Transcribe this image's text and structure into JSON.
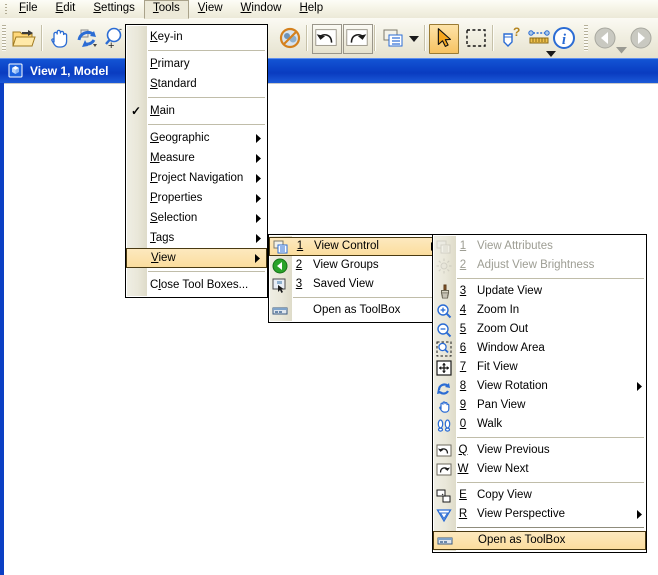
{
  "window": {
    "view_title": "View 1, Model",
    "view_title_icon": "view-cube-icon"
  },
  "menubar": {
    "items": [
      {
        "label": "File",
        "accel": "F",
        "open": false,
        "name": "menu-file"
      },
      {
        "label": "Edit",
        "accel": "E",
        "open": false,
        "name": "menu-edit"
      },
      {
        "label": "Settings",
        "accel": "S",
        "open": false,
        "name": "menu-settings"
      },
      {
        "label": "Tools",
        "accel": "T",
        "open": true,
        "name": "menu-tools"
      },
      {
        "label": "View",
        "accel": "V",
        "open": false,
        "name": "menu-view"
      },
      {
        "label": "Window",
        "accel": "W",
        "open": false,
        "name": "menu-window"
      },
      {
        "label": "Help",
        "accel": "H",
        "open": false,
        "name": "menu-help"
      }
    ]
  },
  "toolbar": {
    "buttons": [
      {
        "name": "open-folder-icon",
        "selected": false
      },
      {
        "name": "pan-hand-icon",
        "selected": false
      },
      {
        "name": "rotate-view-icon",
        "selected": false
      },
      {
        "name": "zoom-in-icon",
        "selected": false
      },
      {
        "name": "toolbox-icon",
        "selected": false
      },
      {
        "name": "no-entry-icon",
        "selected": false
      },
      {
        "name": "undo-icon",
        "selected": false
      },
      {
        "name": "redo-icon",
        "selected": false
      },
      {
        "name": "view-groups-icon",
        "selected": false
      },
      {
        "name": "select-arrow-icon",
        "selected": true
      },
      {
        "name": "fence-select-icon",
        "selected": false
      },
      {
        "name": "element-info-icon",
        "selected": false
      },
      {
        "name": "measure-distance-icon",
        "selected": false
      },
      {
        "name": "info-icon",
        "selected": false
      },
      {
        "name": "back-arrow-icon",
        "selected": false
      },
      {
        "name": "forward-arrow-icon",
        "selected": false
      }
    ]
  },
  "tools_menu": {
    "items": [
      {
        "type": "item",
        "label": "Key-in",
        "accel": "K",
        "checked": false,
        "submenu": false,
        "disabled": false,
        "highlighted": false,
        "name": "tools-key-in"
      },
      {
        "type": "sep"
      },
      {
        "type": "item",
        "label": "Primary",
        "accel": "P",
        "checked": false,
        "submenu": false,
        "disabled": false,
        "highlighted": false,
        "name": "tools-primary"
      },
      {
        "type": "item",
        "label": "Standard",
        "accel": "S",
        "checked": false,
        "submenu": false,
        "disabled": false,
        "highlighted": false,
        "name": "tools-standard"
      },
      {
        "type": "sep"
      },
      {
        "type": "item",
        "label": "Main",
        "accel": "M",
        "checked": true,
        "submenu": false,
        "disabled": false,
        "highlighted": false,
        "name": "tools-main"
      },
      {
        "type": "sep"
      },
      {
        "type": "item",
        "label": "Geographic",
        "accel": "G",
        "checked": false,
        "submenu": true,
        "disabled": false,
        "highlighted": false,
        "name": "tools-geographic"
      },
      {
        "type": "item",
        "label": "Measure",
        "accel": "M",
        "checked": false,
        "submenu": true,
        "disabled": false,
        "highlighted": false,
        "name": "tools-measure"
      },
      {
        "type": "item",
        "label": "Project Navigation",
        "accel": "P",
        "checked": false,
        "submenu": true,
        "disabled": false,
        "highlighted": false,
        "name": "tools-project-navigation"
      },
      {
        "type": "item",
        "label": "Properties",
        "accel": "P",
        "checked": false,
        "submenu": true,
        "disabled": false,
        "highlighted": false,
        "name": "tools-properties"
      },
      {
        "type": "item",
        "label": "Selection",
        "accel": "S",
        "checked": false,
        "submenu": true,
        "disabled": false,
        "highlighted": false,
        "name": "tools-selection"
      },
      {
        "type": "item",
        "label": "Tags",
        "accel": "T",
        "checked": false,
        "submenu": true,
        "disabled": false,
        "highlighted": false,
        "name": "tools-tags"
      },
      {
        "type": "item",
        "label": "View",
        "accel": "V",
        "checked": false,
        "submenu": true,
        "disabled": false,
        "highlighted": true,
        "name": "tools-view"
      },
      {
        "type": "sep"
      },
      {
        "type": "item",
        "label": "Close Tool Boxes...",
        "accel": "l",
        "checked": false,
        "submenu": false,
        "disabled": false,
        "highlighted": false,
        "name": "tools-close-tool-boxes"
      }
    ]
  },
  "view_submenu": {
    "items": [
      {
        "type": "item",
        "num": "1",
        "label": "View Control",
        "submenu": true,
        "highlighted": true,
        "icon": "view-control-icon",
        "name": "view-control"
      },
      {
        "type": "item",
        "num": "2",
        "label": "View Groups",
        "submenu": true,
        "highlighted": false,
        "icon": "view-groups-green-icon",
        "name": "view-groups"
      },
      {
        "type": "item",
        "num": "3",
        "label": "Saved View",
        "submenu": true,
        "highlighted": false,
        "icon": "saved-view-icon",
        "name": "saved-view"
      },
      {
        "type": "sep"
      },
      {
        "type": "item",
        "num": "",
        "label": "Open as ToolBox",
        "submenu": false,
        "highlighted": false,
        "icon": "toolbox-bar-icon",
        "name": "view-open-as-toolbox"
      }
    ]
  },
  "view_control_submenu": {
    "items": [
      {
        "type": "item",
        "num": "1",
        "label": "View Attributes",
        "disabled": true,
        "submenu": false,
        "highlighted": false,
        "icon": "view-attributes-icon",
        "name": "vc-view-attributes"
      },
      {
        "type": "item",
        "num": "2",
        "label": "Adjust View Brightness",
        "disabled": true,
        "submenu": false,
        "highlighted": false,
        "icon": "brightness-icon",
        "name": "vc-adjust-view-brightness"
      },
      {
        "type": "sep"
      },
      {
        "type": "item",
        "num": "3",
        "label": "Update View",
        "disabled": false,
        "submenu": false,
        "highlighted": false,
        "icon": "update-view-brush-icon",
        "name": "vc-update-view"
      },
      {
        "type": "item",
        "num": "4",
        "label": "Zoom In",
        "disabled": false,
        "submenu": false,
        "highlighted": false,
        "icon": "zoom-in-icon",
        "name": "vc-zoom-in"
      },
      {
        "type": "item",
        "num": "5",
        "label": "Zoom Out",
        "disabled": false,
        "submenu": false,
        "highlighted": false,
        "icon": "zoom-out-icon",
        "name": "vc-zoom-out"
      },
      {
        "type": "item",
        "num": "6",
        "label": "Window Area",
        "disabled": false,
        "submenu": false,
        "highlighted": false,
        "icon": "window-area-icon",
        "name": "vc-window-area"
      },
      {
        "type": "item",
        "num": "7",
        "label": "Fit View",
        "disabled": false,
        "submenu": false,
        "highlighted": false,
        "icon": "fit-view-icon",
        "name": "vc-fit-view"
      },
      {
        "type": "item",
        "num": "8",
        "label": "View Rotation",
        "disabled": false,
        "submenu": true,
        "highlighted": false,
        "icon": "view-rotation-icon",
        "name": "vc-view-rotation"
      },
      {
        "type": "item",
        "num": "9",
        "label": "Pan View",
        "disabled": false,
        "submenu": false,
        "highlighted": false,
        "icon": "pan-hand-icon",
        "name": "vc-pan-view"
      },
      {
        "type": "item",
        "num": "0",
        "label": "Walk",
        "disabled": false,
        "submenu": false,
        "highlighted": false,
        "icon": "walk-feet-icon",
        "name": "vc-walk"
      },
      {
        "type": "sep"
      },
      {
        "type": "item",
        "num": "Q",
        "label": "View Previous",
        "disabled": false,
        "submenu": false,
        "highlighted": false,
        "icon": "view-previous-icon",
        "name": "vc-view-previous"
      },
      {
        "type": "item",
        "num": "W",
        "label": "View Next",
        "disabled": false,
        "submenu": false,
        "highlighted": false,
        "icon": "view-next-icon",
        "name": "vc-view-next"
      },
      {
        "type": "sep"
      },
      {
        "type": "item",
        "num": "E",
        "label": "Copy View",
        "disabled": false,
        "submenu": false,
        "highlighted": false,
        "icon": "copy-view-icon",
        "name": "vc-copy-view"
      },
      {
        "type": "item",
        "num": "R",
        "label": "View Perspective",
        "disabled": false,
        "submenu": true,
        "highlighted": false,
        "icon": "view-perspective-icon",
        "name": "vc-view-perspective"
      },
      {
        "type": "sep-thin"
      },
      {
        "type": "item",
        "num": "",
        "label": "Open as ToolBox",
        "disabled": false,
        "submenu": false,
        "highlighted": true,
        "icon": "toolbox-bar-icon",
        "name": "vc-open-as-toolbox"
      }
    ]
  },
  "colors": {
    "title_bar_blue": "#0b3fc4",
    "menu_highlight": "#fbdd9e",
    "toolbar_bg": "#ece9d8",
    "disabled_text": "#9d9d93"
  }
}
